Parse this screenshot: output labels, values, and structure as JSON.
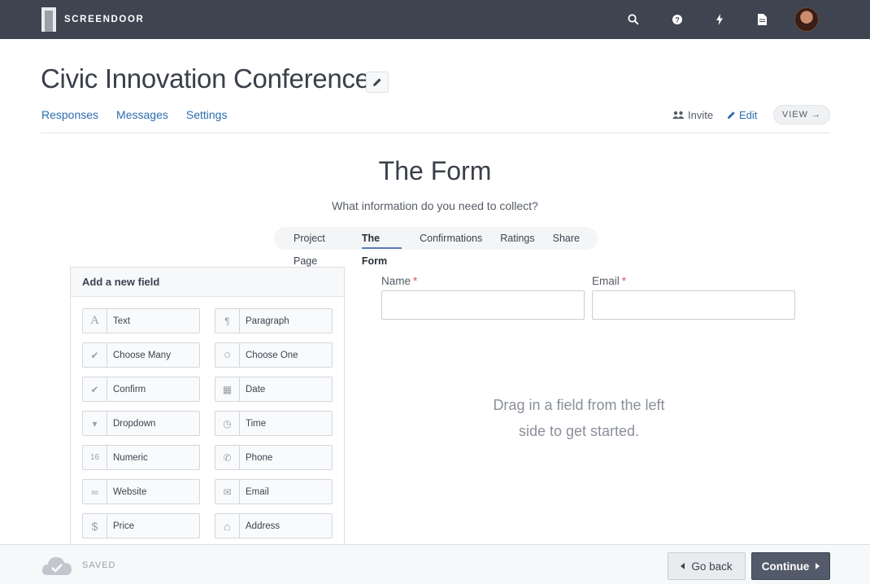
{
  "topbar": {
    "brand": "SCREENDOOR",
    "icons": [
      "search-icon",
      "help-icon",
      "lightning-icon",
      "document-icon"
    ],
    "avatar": "user-avatar"
  },
  "header": {
    "project_title": "Civic Innovation Conference",
    "nav": [
      "Responses",
      "Messages",
      "Settings"
    ],
    "invite_label": "Invite",
    "edit_label": "Edit",
    "view_label": "VIEW →"
  },
  "section": {
    "title": "The Form",
    "subtitle": "What information do you need to collect?",
    "steps": [
      "Project Page",
      "The Form",
      "Confirmations",
      "Ratings",
      "Share"
    ],
    "active_step": "The Form"
  },
  "field_panel": {
    "title": "Add a new field",
    "fields": [
      {
        "label": "Text",
        "icon": "A"
      },
      {
        "label": "Paragraph",
        "icon": "¶"
      },
      {
        "label": "Choose Many",
        "icon": "✔"
      },
      {
        "label": "Choose One",
        "icon": "○"
      },
      {
        "label": "Confirm",
        "icon": "✔"
      },
      {
        "label": "Date",
        "icon": "▦"
      },
      {
        "label": "Dropdown",
        "icon": "▾"
      },
      {
        "label": "Time",
        "icon": "◷"
      },
      {
        "label": "Numeric",
        "icon": "16"
      },
      {
        "label": "Phone",
        "icon": "✆"
      },
      {
        "label": "Website",
        "icon": "∞"
      },
      {
        "label": "Email",
        "icon": "✉"
      },
      {
        "label": "Price",
        "icon": "$"
      },
      {
        "label": "Address",
        "icon": "⌂"
      }
    ]
  },
  "form": {
    "name_label": "Name",
    "email_label": "Email",
    "required_mark": "*",
    "name_value": "",
    "email_value": "",
    "hint_line1": "Drag in a field from the left",
    "hint_line2": "side to get started."
  },
  "footer": {
    "saved_label": "SAVED",
    "back_label": "Go back",
    "continue_label": "Continue"
  },
  "colors": {
    "topbar": "#3e4450",
    "link": "#2b6cb0",
    "required": "#d9534f",
    "continue_button": "#535b6a"
  }
}
